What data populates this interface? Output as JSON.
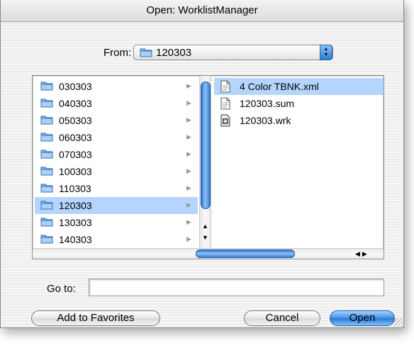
{
  "window": {
    "title": "Open: WorklistManager"
  },
  "from": {
    "label": "From:",
    "selected": "120303"
  },
  "folders": [
    {
      "name": "030303",
      "selected": false
    },
    {
      "name": "040303",
      "selected": false
    },
    {
      "name": "050303",
      "selected": false
    },
    {
      "name": "060303",
      "selected": false
    },
    {
      "name": "070303",
      "selected": false
    },
    {
      "name": "100303",
      "selected": false
    },
    {
      "name": "110303",
      "selected": false
    },
    {
      "name": "120303",
      "selected": true
    },
    {
      "name": "130303",
      "selected": false
    },
    {
      "name": "140303",
      "selected": false
    }
  ],
  "files": [
    {
      "name": "4 Color TBNK.xml",
      "icon": "document-icon",
      "selected": true
    },
    {
      "name": "120303.sum",
      "icon": "document-icon",
      "selected": false
    },
    {
      "name": "120303.wrk",
      "icon": "app-document-icon",
      "selected": false
    }
  ],
  "goto": {
    "label": "Go to:",
    "value": ""
  },
  "buttons": {
    "add_favorites": "Add to Favorites",
    "cancel": "Cancel",
    "open": "Open"
  },
  "colors": {
    "selection": "#b5d5ff",
    "accent": "#3f8ee4"
  }
}
